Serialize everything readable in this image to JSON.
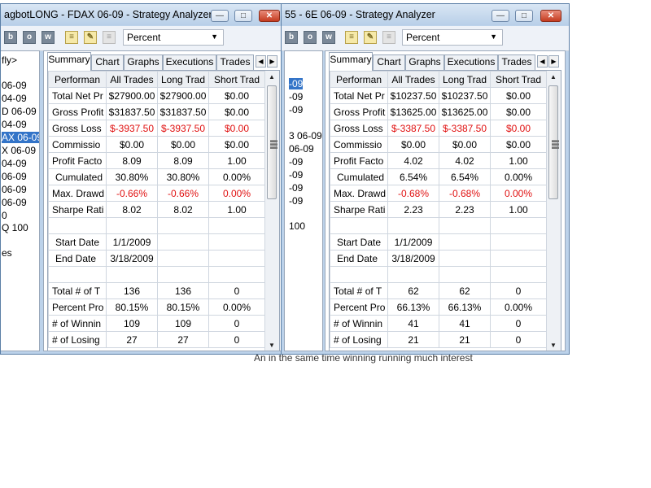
{
  "background_text": "An in the same time winning running much interest",
  "toolbar": {
    "tool_icons": [
      "b",
      "o",
      "w"
    ],
    "percent_selector": "Percent"
  },
  "table_header": [
    "Performan",
    "All Trades",
    "Long Trad",
    "Short Trad"
  ],
  "windows": [
    {
      "title": "agbotLONG - FDAX 06-09 - Strategy Analyzer",
      "tabs": [
        "Summary",
        "Chart",
        "Graphs",
        "Executions",
        "Trades"
      ],
      "instrument_list": [
        "fly>",
        "06-09",
        "04-09",
        "D 06-09",
        "04-09",
        "AX 06-09",
        "X 06-09",
        "04-09",
        "06-09",
        "06-09",
        "06-09",
        "0",
        "Q 100",
        "es"
      ],
      "rows": [
        {
          "label": "Total Net Pr",
          "all": "$27900.00",
          "long": "$27900.00",
          "short": "$0.00"
        },
        {
          "label": "Gross Profit",
          "all": "$31837.50",
          "long": "$31837.50",
          "short": "$0.00"
        },
        {
          "label": "Gross Loss",
          "all": "$-3937.50",
          "long": "$-3937.50",
          "short": "$0.00",
          "neg": true
        },
        {
          "label": "Commissio",
          "all": "$0.00",
          "long": "$0.00",
          "short": "$0.00"
        },
        {
          "label": "Profit Facto",
          "all": "8.09",
          "long": "8.09",
          "short": "1.00"
        },
        {
          "label": "Cumulated",
          "all": "30.80%",
          "long": "30.80%",
          "short": "0.00%",
          "ind": true
        },
        {
          "label": "Max. Drawd",
          "all": "-0.66%",
          "long": "-0.66%",
          "short": "0.00%",
          "neg": true
        },
        {
          "label": "Sharpe Rati",
          "all": "8.02",
          "long": "8.02",
          "short": "1.00"
        },
        {
          "label": "",
          "all": "",
          "long": "",
          "short": ""
        },
        {
          "label": "Start Date",
          "all": "1/1/2009",
          "long": "",
          "short": "",
          "ind": true
        },
        {
          "label": "End Date",
          "all": "3/18/2009",
          "long": "",
          "short": "",
          "ind": true
        },
        {
          "label": "",
          "all": "",
          "long": "",
          "short": ""
        },
        {
          "label": "Total # of T",
          "all": "136",
          "long": "136",
          "short": "0"
        },
        {
          "label": "Percent Pro",
          "all": "80.15%",
          "long": "80.15%",
          "short": "0.00%"
        },
        {
          "label": "# of Winnin",
          "all": "109",
          "long": "109",
          "short": "0"
        },
        {
          "label": "# of Losing",
          "all": "27",
          "long": "27",
          "short": "0"
        }
      ]
    },
    {
      "title": "55 - 6E 06-09 - Strategy Analyzer",
      "tabs": [
        "Summary",
        "Chart",
        "Graphs",
        "Executions",
        "Trades"
      ],
      "instrument_list": [
        "-09",
        "-09",
        "-09",
        "3 06-09",
        "06-09",
        "-09",
        "-09",
        "-09",
        "-09",
        "100"
      ],
      "rows": [
        {
          "label": "Total Net Pr",
          "all": "$10237.50",
          "long": "$10237.50",
          "short": "$0.00"
        },
        {
          "label": "Gross Profit",
          "all": "$13625.00",
          "long": "$13625.00",
          "short": "$0.00"
        },
        {
          "label": "Gross Loss",
          "all": "$-3387.50",
          "long": "$-3387.50",
          "short": "$0.00",
          "neg": true
        },
        {
          "label": "Commissio",
          "all": "$0.00",
          "long": "$0.00",
          "short": "$0.00"
        },
        {
          "label": "Profit Facto",
          "all": "4.02",
          "long": "4.02",
          "short": "1.00"
        },
        {
          "label": "Cumulated",
          "all": "6.54%",
          "long": "6.54%",
          "short": "0.00%",
          "ind": true
        },
        {
          "label": "Max. Drawd",
          "all": "-0.68%",
          "long": "-0.68%",
          "short": "0.00%",
          "neg": true
        },
        {
          "label": "Sharpe Rati",
          "all": "2.23",
          "long": "2.23",
          "short": "1.00"
        },
        {
          "label": "",
          "all": "",
          "long": "",
          "short": ""
        },
        {
          "label": "Start Date",
          "all": "1/1/2009",
          "long": "",
          "short": "",
          "ind": true
        },
        {
          "label": "End Date",
          "all": "3/18/2009",
          "long": "",
          "short": "",
          "ind": true
        },
        {
          "label": "",
          "all": "",
          "long": "",
          "short": ""
        },
        {
          "label": "Total # of T",
          "all": "62",
          "long": "62",
          "short": "0"
        },
        {
          "label": "Percent Pro",
          "all": "66.13%",
          "long": "66.13%",
          "short": "0.00%"
        },
        {
          "label": "# of Winnin",
          "all": "41",
          "long": "41",
          "short": "0"
        },
        {
          "label": "# of Losing",
          "all": "21",
          "long": "21",
          "short": "0"
        }
      ]
    }
  ],
  "colors": {
    "negative": "#e01010",
    "selection": "#3374c8"
  }
}
